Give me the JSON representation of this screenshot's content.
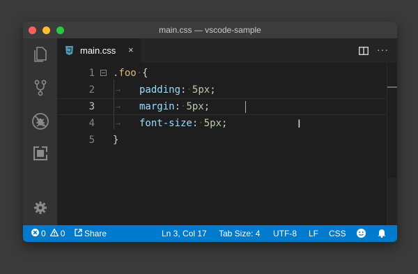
{
  "window": {
    "title": "main.css — vscode-sample"
  },
  "tab": {
    "label": "main.css",
    "close": "×",
    "icon": "css-file-icon"
  },
  "editor_actions": {
    "more": "···"
  },
  "editor": {
    "lines": [
      {
        "num": "1",
        "selector": ".foo",
        "brace": "{"
      },
      {
        "num": "2",
        "prop": "padding",
        "value": "5px"
      },
      {
        "num": "3",
        "prop": "margin",
        "value": "5px"
      },
      {
        "num": "4",
        "prop": "font-size",
        "value": "5px"
      },
      {
        "num": "5",
        "brace": "}"
      }
    ],
    "colon": ":",
    "semicolon": ";",
    "arrow": "→",
    "dot": "·",
    "ibeam": "I"
  },
  "status": {
    "errors": "0",
    "warnings": "0",
    "share": "Share",
    "position": "Ln 3, Col 17",
    "tab_size": "Tab Size: 4",
    "encoding": "UTF-8",
    "eol": "LF",
    "language": "CSS"
  },
  "colors": {
    "statusbar": "#007acc",
    "activitybar": "#333333",
    "editor_bg": "#1e1e1e",
    "selector": "#d7ba7d",
    "property": "#9cdcfe",
    "number": "#b5cea8"
  }
}
